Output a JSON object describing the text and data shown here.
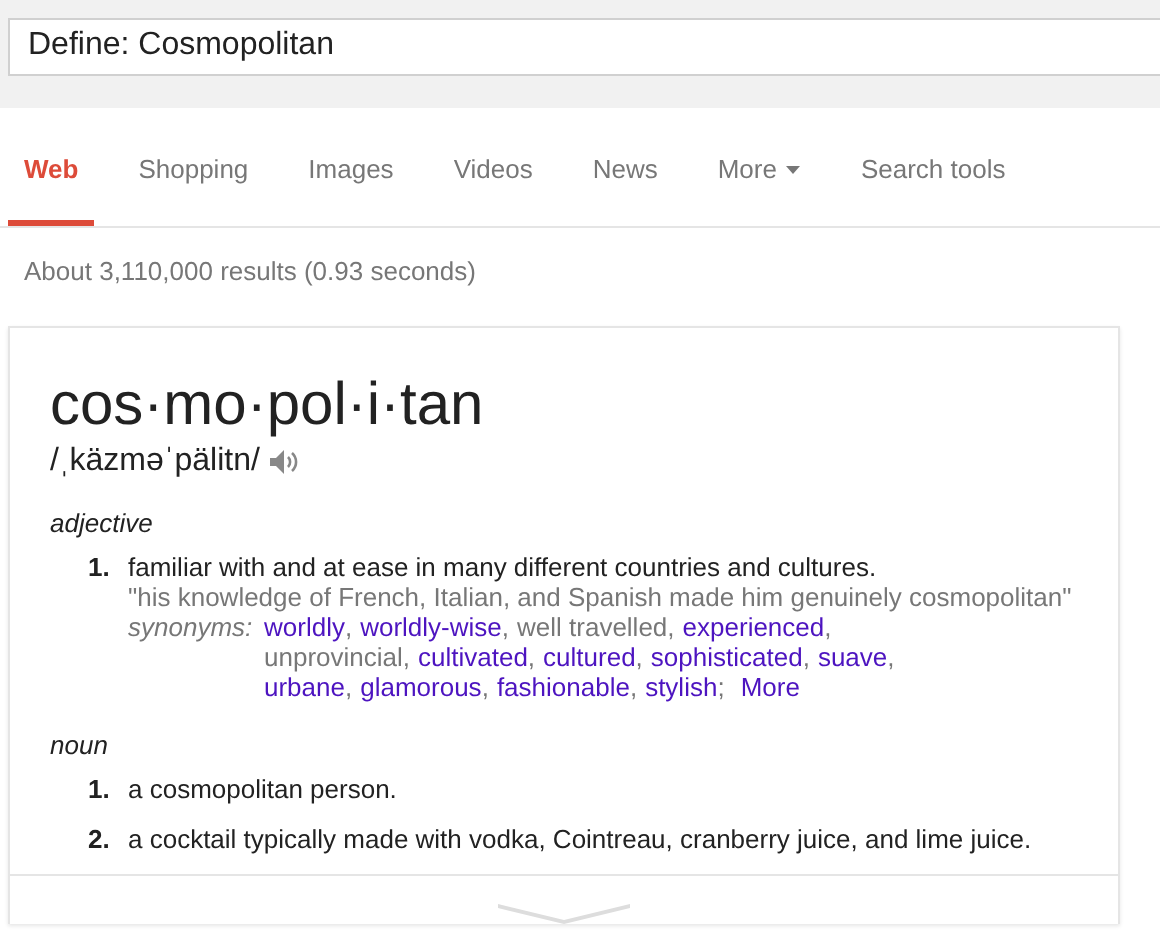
{
  "search": {
    "value": "Define: Cosmopolitan"
  },
  "tabs": [
    {
      "label": "Web",
      "selected": true,
      "dropdown": false
    },
    {
      "label": "Shopping",
      "selected": false,
      "dropdown": false
    },
    {
      "label": "Images",
      "selected": false,
      "dropdown": false
    },
    {
      "label": "Videos",
      "selected": false,
      "dropdown": false
    },
    {
      "label": "News",
      "selected": false,
      "dropdown": false
    },
    {
      "label": "More",
      "selected": false,
      "dropdown": true
    },
    {
      "label": "Search tools",
      "selected": false,
      "dropdown": false
    }
  ],
  "result_stats": "About 3,110,000 results (0.93 seconds)",
  "definition": {
    "word": "cos·mo·pol·i·tan",
    "pronunciation": "/ˌkäzməˈpälitn/",
    "senses": [
      {
        "part_of_speech": "adjective",
        "meanings": [
          {
            "number": "1.",
            "text": "familiar with and at ease in many different countries and cultures.",
            "example": "\"his knowledge of French, Italian, and Spanish made him genuinely cosmopolitan\"",
            "synonyms_label": "synonyms:",
            "synonyms": [
              {
                "text": "worldly",
                "link": true,
                "sep": ","
              },
              {
                "text": "worldly-wise",
                "link": true,
                "sep": ","
              },
              {
                "text": "well travelled",
                "link": false,
                "sep": ","
              },
              {
                "text": "experienced",
                "link": true,
                "sep": ","
              },
              {
                "text": "unprovincial",
                "link": false,
                "sep": ","
              },
              {
                "text": "cultivated",
                "link": true,
                "sep": ","
              },
              {
                "text": "cultured",
                "link": true,
                "sep": ","
              },
              {
                "text": "sophisticated",
                "link": true,
                "sep": ","
              },
              {
                "text": "suave",
                "link": true,
                "sep": ","
              },
              {
                "text": "urbane",
                "link": true,
                "sep": ","
              },
              {
                "text": "glamorous",
                "link": true,
                "sep": ","
              },
              {
                "text": "fashionable",
                "link": true,
                "sep": ","
              },
              {
                "text": "stylish",
                "link": true,
                "sep": ";"
              }
            ],
            "more": "More"
          }
        ]
      },
      {
        "part_of_speech": "noun",
        "meanings": [
          {
            "number": "1.",
            "text": "a cosmopolitan person."
          },
          {
            "number": "2.",
            "text": "a cocktail typically made with vodka, Cointreau, cranberry juice, and lime juice."
          }
        ]
      }
    ]
  }
}
